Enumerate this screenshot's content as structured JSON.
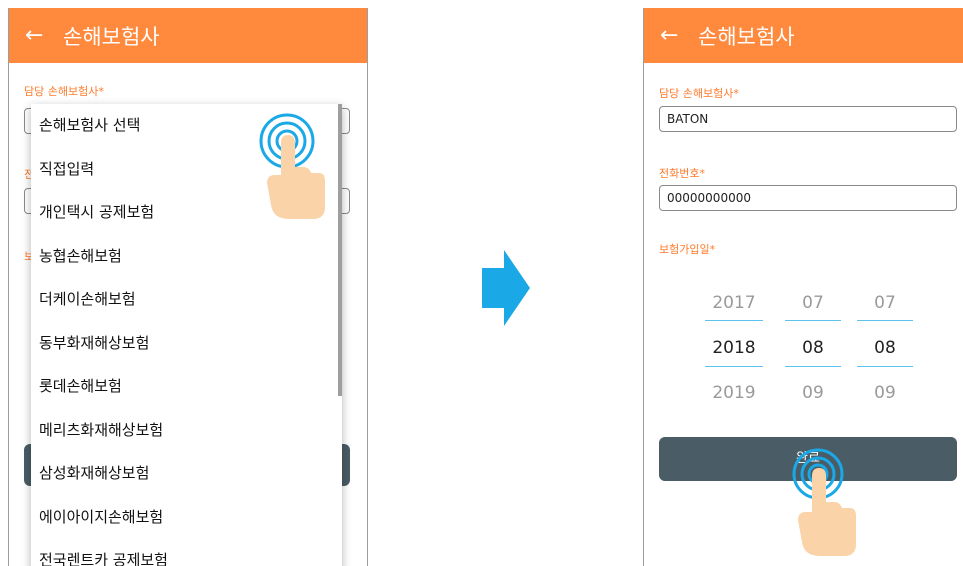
{
  "left_screen": {
    "header": {
      "back_icon": "←",
      "title": "손해보험사"
    },
    "insurer_label": "담당 손해보험사*",
    "dropdown_items": [
      "손해보험사 선택",
      "직접입력",
      "개인택시 공제보험",
      "농협손해보험",
      "더케이손해보험",
      "동부화재해상보험",
      "롯데손해보험",
      "메리츠화재해상보험",
      "삼성화재해상보험",
      "에이아이지손해보험",
      "전국렌트카 공제보험"
    ],
    "partial_label_1": "전",
    "partial_label_2": "보"
  },
  "right_screen": {
    "header": {
      "back_icon": "←",
      "title": "손해보험사"
    },
    "insurer_label": "담당 손해보험사*",
    "insurer_value": "BATON",
    "phone_label": "전화번호*",
    "phone_value": "00000000000",
    "date_label": "보험가입일*",
    "date_picker": {
      "year": {
        "prev": "2017",
        "selected": "2018",
        "next": "2019"
      },
      "month": {
        "prev": "07",
        "selected": "08",
        "next": "09"
      },
      "day": {
        "prev": "07",
        "selected": "08",
        "next": "09"
      }
    },
    "confirm_button": "완료"
  },
  "colors": {
    "header": "#ff8a3d",
    "label": "#ff7a2a",
    "button": "#4a5c66",
    "accent": "#5cc3ef",
    "arrow": "#1aa9e6"
  }
}
